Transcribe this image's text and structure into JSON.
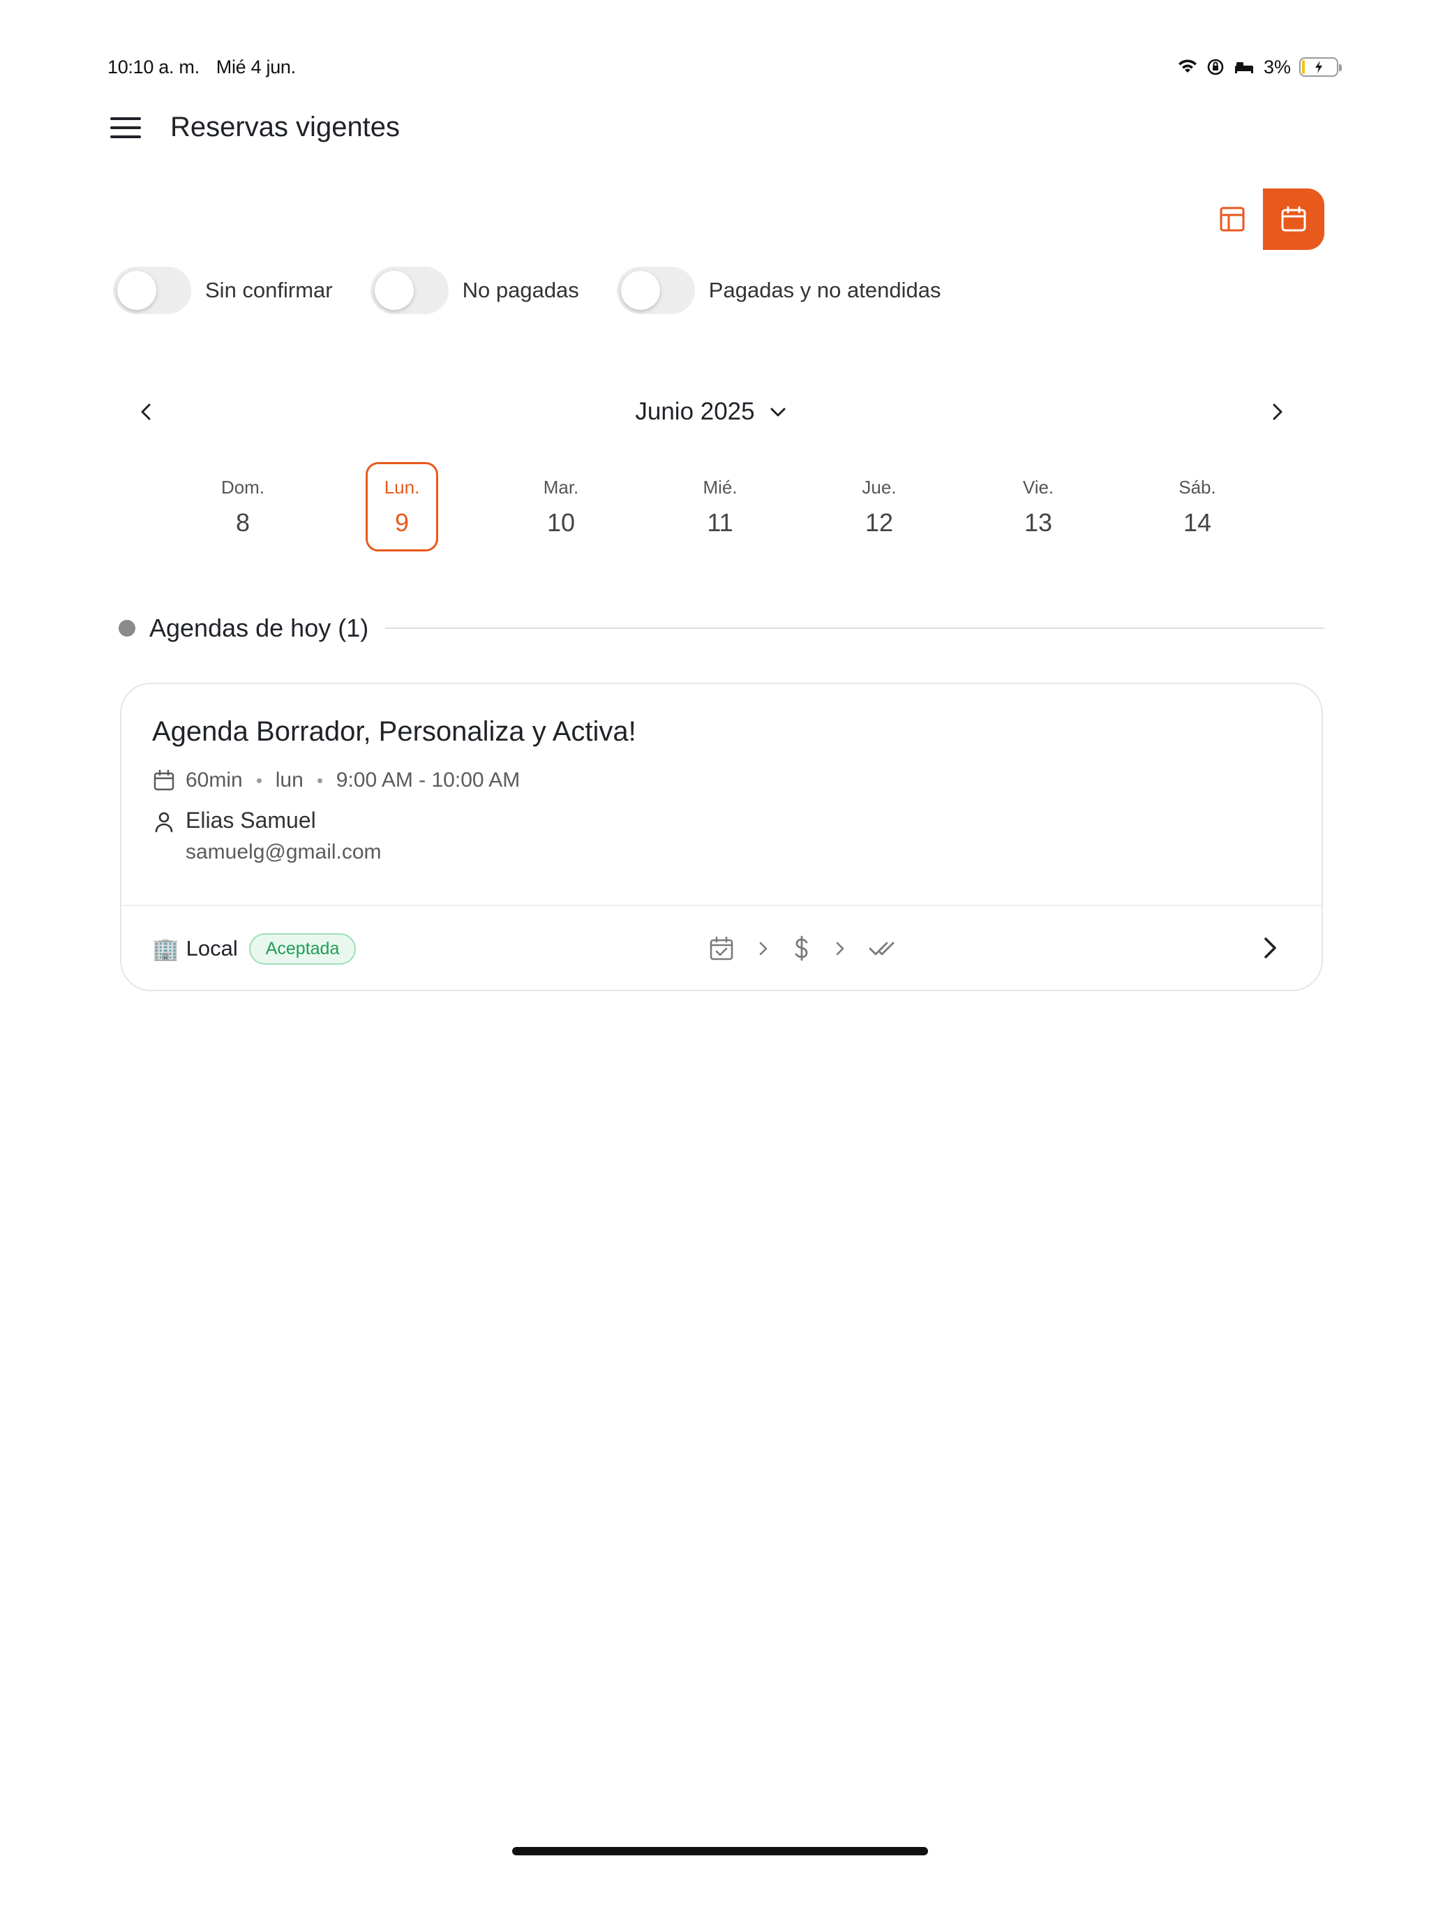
{
  "status_bar": {
    "time": "10:10 a. m.",
    "date": "Mié 4 jun.",
    "battery": "3%"
  },
  "header": {
    "title": "Reservas vigentes"
  },
  "filters": [
    {
      "label": "Sin confirmar",
      "on": false
    },
    {
      "label": "No pagadas",
      "on": false
    },
    {
      "label": "Pagadas y no atendidas",
      "on": false
    }
  ],
  "calendar": {
    "month_label": "Junio 2025",
    "days": [
      {
        "name": "Dom.",
        "num": "8"
      },
      {
        "name": "Lun.",
        "num": "9"
      },
      {
        "name": "Mar.",
        "num": "10"
      },
      {
        "name": "Mié.",
        "num": "11"
      },
      {
        "name": "Jue.",
        "num": "12"
      },
      {
        "name": "Vie.",
        "num": "13"
      },
      {
        "name": "Sáb.",
        "num": "14"
      }
    ],
    "selected_index": 1
  },
  "section": {
    "title": "Agendas de hoy (1)"
  },
  "appointment": {
    "title": "Agenda Borrador, Personaliza y Activa!",
    "duration": "60min",
    "weekday": "lun",
    "time_range": "9:00 AM - 10:00 AM",
    "client_name": "Elias Samuel",
    "client_email": "samuelg@gmail.com",
    "location": "Local",
    "location_emoji": "🏢",
    "status": "Aceptada"
  },
  "colors": {
    "accent": "#e8591c",
    "success": "#1f9d55"
  }
}
